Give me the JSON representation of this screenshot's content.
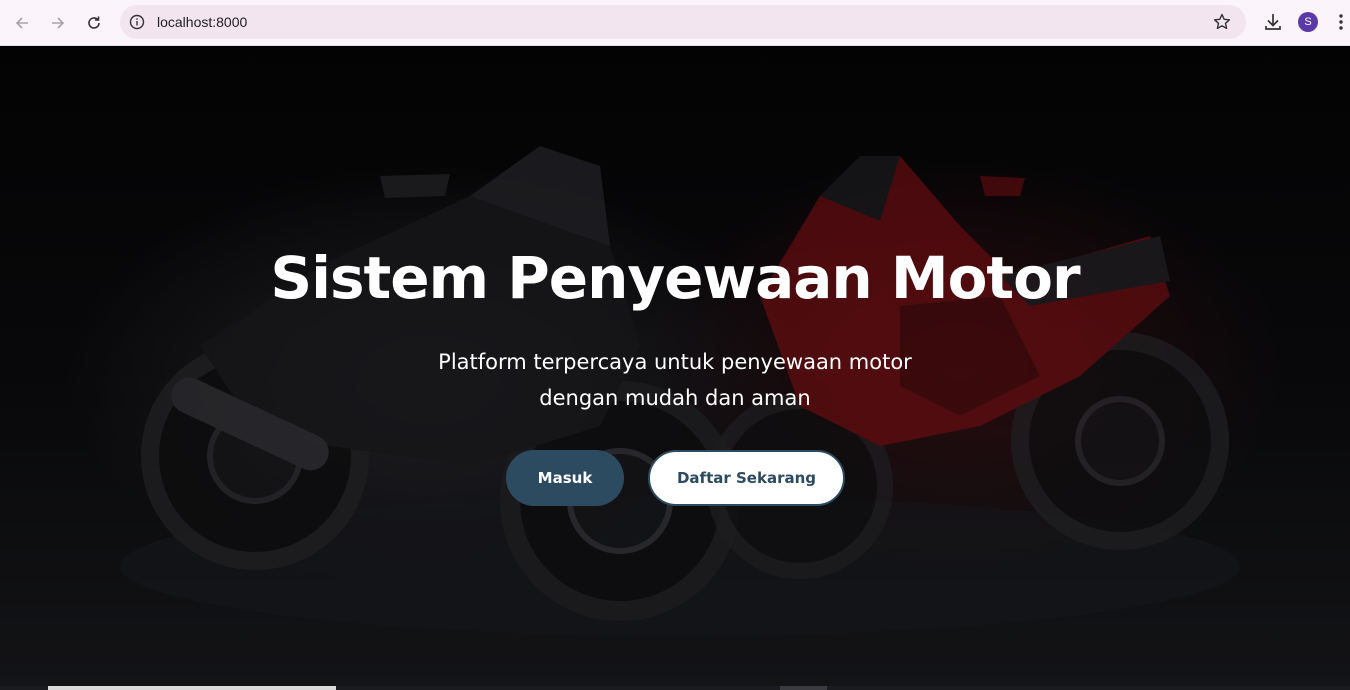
{
  "browser": {
    "url": "localhost:8000",
    "avatar_letter": "S",
    "icons": {
      "back": "arrow-left-icon",
      "forward": "arrow-right-icon",
      "reload": "reload-icon",
      "info": "info-icon",
      "bookmark": "star-icon",
      "download": "download-icon",
      "menu": "kebab-menu-icon"
    }
  },
  "hero": {
    "title": "Sistem Penyewaan Motor",
    "subtitle_line1": "Platform terpercaya untuk penyewaan motor",
    "subtitle_line2": "dengan mudah dan aman",
    "login_label": "Masuk",
    "register_label": "Daftar Sekarang"
  },
  "colors": {
    "primary": "#2c4a60",
    "hero_text": "#ffffff",
    "motor_red": "#b3161c"
  }
}
